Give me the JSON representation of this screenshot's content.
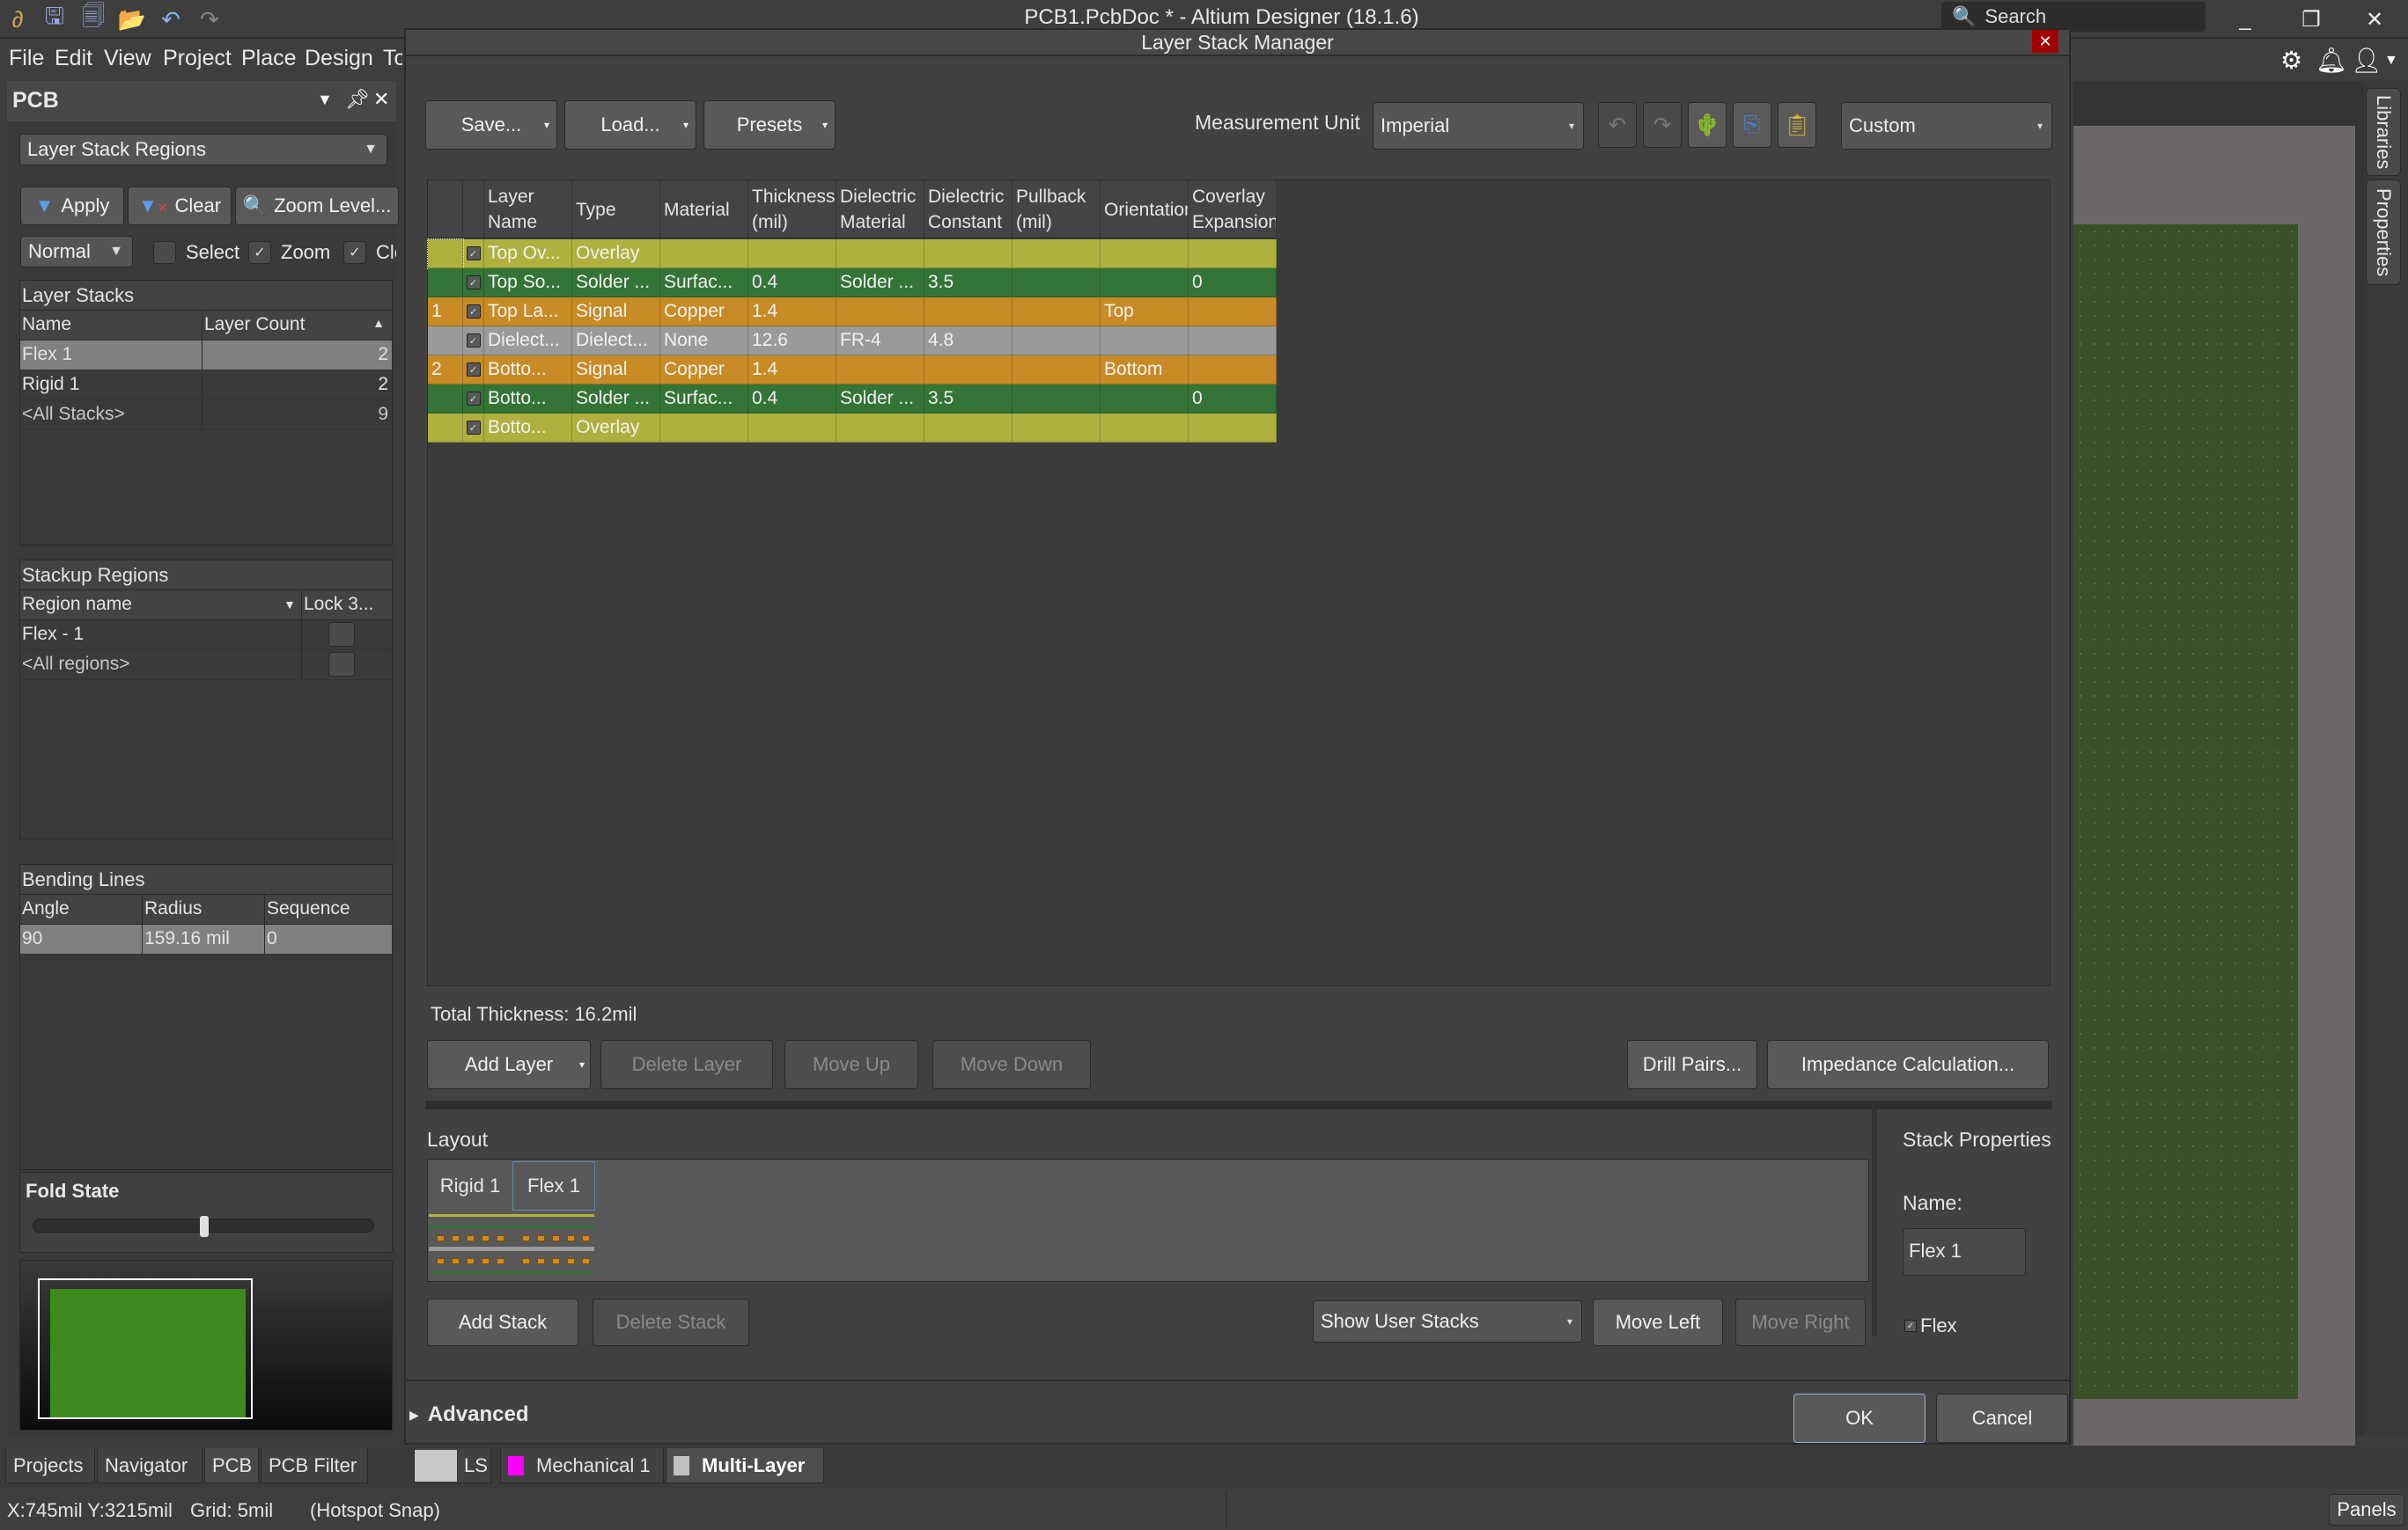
{
  "app": {
    "title": "PCB1.PcbDoc * - Altium Designer (18.1.6)",
    "search_placeholder": "Search",
    "toolbar_icons": [
      "altium-logo-icon",
      "save-icon",
      "save-all-icon",
      "open-folder-icon",
      "undo-icon",
      "redo-icon"
    ],
    "window_controls": {
      "minimize": "_",
      "restore": "❐",
      "close": "✕"
    }
  },
  "menu": {
    "items": [
      "File",
      "Edit",
      "View",
      "Project",
      "Place",
      "Design",
      "To"
    ],
    "right_icons": [
      "gear-icon",
      "bell-icon",
      "user-icon"
    ]
  },
  "left_panel": {
    "title": "PCB",
    "mode_dropdown": "Layer Stack Regions",
    "apply_label": "Apply",
    "clear_label": "Clear",
    "zoom_level_label": "Zoom Level...",
    "filter_mode": "Normal",
    "select_label": "Select",
    "select_checked": false,
    "zoom_label": "Zoom",
    "zoom_checked": true,
    "clear_chk_label": "Cle",
    "clear_checked": true,
    "layer_stacks": {
      "title": "Layer Stacks",
      "columns": [
        "Name",
        "Layer Count"
      ],
      "rows": [
        {
          "name": "Flex 1",
          "count": "2",
          "selected": true
        },
        {
          "name": "Rigid 1",
          "count": "2",
          "selected": false
        },
        {
          "name": "<All Stacks>",
          "count": "9",
          "selected": false
        }
      ]
    },
    "stackup_regions": {
      "title": "Stackup Regions",
      "columns": [
        "Region name",
        "Lock 3..."
      ],
      "rows": [
        {
          "name": "Flex - 1",
          "locked": false
        },
        {
          "name": "<All regions>",
          "locked": false
        }
      ]
    },
    "bending_lines": {
      "title": "Bending Lines",
      "columns": [
        "Angle",
        "Radius",
        "Sequence"
      ],
      "rows": [
        {
          "angle": "90",
          "radius": "159.16 mil",
          "sequence": "0"
        }
      ]
    },
    "fold_state": {
      "title": "Fold State",
      "value_fraction": 0.5
    }
  },
  "dialog": {
    "title": "Layer Stack Manager",
    "save_label": "Save...",
    "load_label": "Load...",
    "presets_label": "Presets",
    "measurement_unit_label": "Measurement Unit",
    "measurement_unit": "Imperial",
    "view_dropdown": "Custom",
    "tool_icons": [
      "undo-icon",
      "redo-icon",
      "3d-view-icon",
      "copy-icon",
      "paste-icon"
    ],
    "table": {
      "columns": [
        [
          "",
          ""
        ],
        [
          "",
          ""
        ],
        [
          "Layer",
          "Name"
        ],
        [
          "Type",
          ""
        ],
        [
          "Material",
          ""
        ],
        [
          "Thickness",
          "(mil)"
        ],
        [
          "Dielectric",
          "Material"
        ],
        [
          "Dielectric",
          "Constant"
        ],
        [
          "Pullback",
          "(mil)"
        ],
        [
          "Orientation",
          ""
        ],
        [
          "Coverlay",
          "Expansion"
        ]
      ],
      "rows": [
        {
          "num": "",
          "enabled": true,
          "name": "Top Ov...",
          "type": "Overlay",
          "material": "",
          "thickness": "",
          "diel_material": "",
          "diel_constant": "",
          "pullback": "",
          "orientation": "",
          "coverlay": "",
          "color": "#b0b03e"
        },
        {
          "num": "",
          "enabled": true,
          "name": "Top So...",
          "type": "Solder ...",
          "material": "Surfac...",
          "thickness": "0.4",
          "diel_material": "Solder ...",
          "diel_constant": "3.5",
          "pullback": "",
          "orientation": "",
          "coverlay": "0",
          "color": "#357437"
        },
        {
          "num": "1",
          "enabled": true,
          "name": "Top La...",
          "type": "Signal",
          "material": "Copper",
          "thickness": "1.4",
          "diel_material": "",
          "diel_constant": "",
          "pullback": "",
          "orientation": "Top",
          "coverlay": "",
          "color": "#c88b25"
        },
        {
          "num": "",
          "enabled": true,
          "name": "Dielect...",
          "type": "Dielect...",
          "material": "None",
          "thickness": "12.6",
          "diel_material": "FR-4",
          "diel_constant": "4.8",
          "pullback": "",
          "orientation": "",
          "coverlay": "",
          "color": "#9a9a9a"
        },
        {
          "num": "2",
          "enabled": true,
          "name": "Botto...",
          "type": "Signal",
          "material": "Copper",
          "thickness": "1.4",
          "diel_material": "",
          "diel_constant": "",
          "pullback": "",
          "orientation": "Bottom",
          "coverlay": "",
          "color": "#c88b25"
        },
        {
          "num": "",
          "enabled": true,
          "name": "Botto...",
          "type": "Solder ...",
          "material": "Surfac...",
          "thickness": "0.4",
          "diel_material": "Solder ...",
          "diel_constant": "3.5",
          "pullback": "",
          "orientation": "",
          "coverlay": "0",
          "color": "#357437"
        },
        {
          "num": "",
          "enabled": true,
          "name": "Botto...",
          "type": "Overlay",
          "material": "",
          "thickness": "",
          "diel_material": "",
          "diel_constant": "",
          "pullback": "",
          "orientation": "",
          "coverlay": "",
          "color": "#b0b03e"
        }
      ]
    },
    "total_thickness": "Total Thickness: 16.2mil",
    "add_layer_label": "Add Layer",
    "delete_layer_label": "Delete Layer",
    "move_up_label": "Move Up",
    "move_down_label": "Move Down",
    "drill_pairs_label": "Drill Pairs...",
    "impedance_label": "Impedance Calculation...",
    "layout": {
      "title": "Layout",
      "stacks": [
        "Rigid 1",
        "Flex 1"
      ],
      "selected_stack": "Flex 1"
    },
    "add_stack_label": "Add Stack",
    "delete_stack_label": "Delete Stack",
    "stack_filter": "Show User Stacks",
    "move_left_label": "Move Left",
    "move_right_label": "Move Right",
    "stack_properties": {
      "title": "Stack Properties",
      "name_label": "Name:",
      "name_value": "Flex 1",
      "flex_label": "Flex",
      "flex_checked": true
    },
    "advanced_label": "Advanced",
    "ok_label": "OK",
    "cancel_label": "Cancel"
  },
  "right_rail": {
    "tabs": [
      "Libraries",
      "Properties"
    ]
  },
  "panel_tabs": [
    "Projects",
    "Navigator",
    "PCB",
    "PCB Filter"
  ],
  "layer_tabs": [
    {
      "label": "LS",
      "color": "#c8c8c8"
    },
    {
      "label": "Mechanical 1",
      "color": "#ff00ff"
    },
    {
      "label": "Multi-Layer",
      "color": "#c0c0c0",
      "active": true
    }
  ],
  "status": {
    "coords": "X:745mil Y:3215mil",
    "grid": "Grid: 5mil",
    "snap": "(Hotspot Snap)",
    "panels_label": "Panels"
  }
}
